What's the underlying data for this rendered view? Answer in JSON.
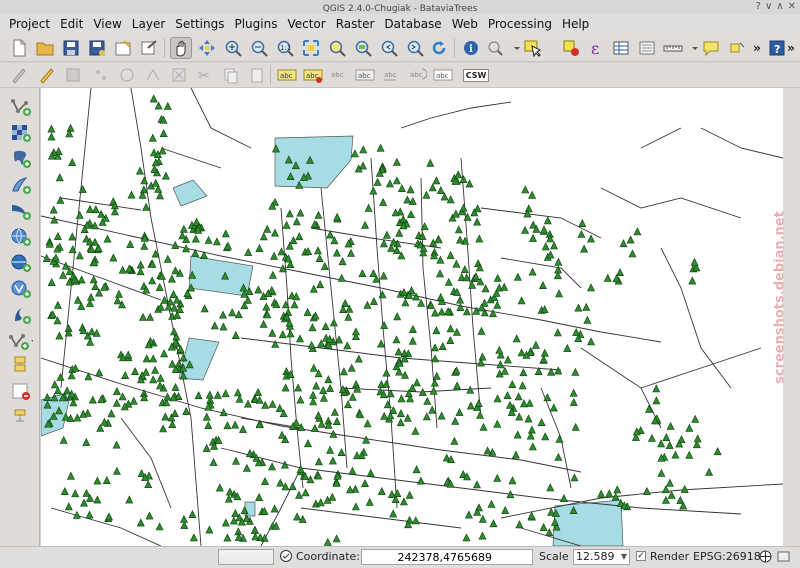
{
  "window": {
    "title": "QGIS 2.4.0-Chugiak - BataviaTrees"
  },
  "menubar": {
    "items": [
      "Project",
      "Edit",
      "View",
      "Layer",
      "Settings",
      "Plugins",
      "Vector",
      "Raster",
      "Database",
      "Web",
      "Processing",
      "Help"
    ]
  },
  "toolbar": {
    "csw_label": "CSW",
    "overflow": "»",
    "icons": [
      "new-project-icon",
      "open-project-icon",
      "save-project-icon",
      "save-as-icon",
      "new-print-composer-icon",
      "composer-manager-icon",
      "pan-icon",
      "pan-to-selection-icon",
      "zoom-in-icon",
      "zoom-out-icon",
      "zoom-native-icon",
      "zoom-full-icon",
      "zoom-to-selection-icon",
      "zoom-to-layer-icon",
      "zoom-last-icon",
      "refresh-icon",
      "identify-icon",
      "map-tips-icon",
      "select-icon",
      "deselect-icon",
      "field-calculator-icon",
      "attribute-table-icon",
      "statistics-icon",
      "measure-icon",
      "annotation-icon",
      "help-icon"
    ]
  },
  "statusbar": {
    "progress_fraction": 0.0,
    "coordinate_label": "Coordinate:",
    "coordinate_value": "242378,4765689",
    "scale_label": "Scale",
    "scale_value": "12.589",
    "render_label": "Render",
    "render_checked": true,
    "crs_label": "EPSG:26918"
  },
  "watermark": "screenshots.debian.net",
  "colors": {
    "tree_fill": "#2e8b2e",
    "tree_stroke": "#0b3d0b",
    "road_stroke": "#333333",
    "water_fill": "#a6dde4"
  }
}
